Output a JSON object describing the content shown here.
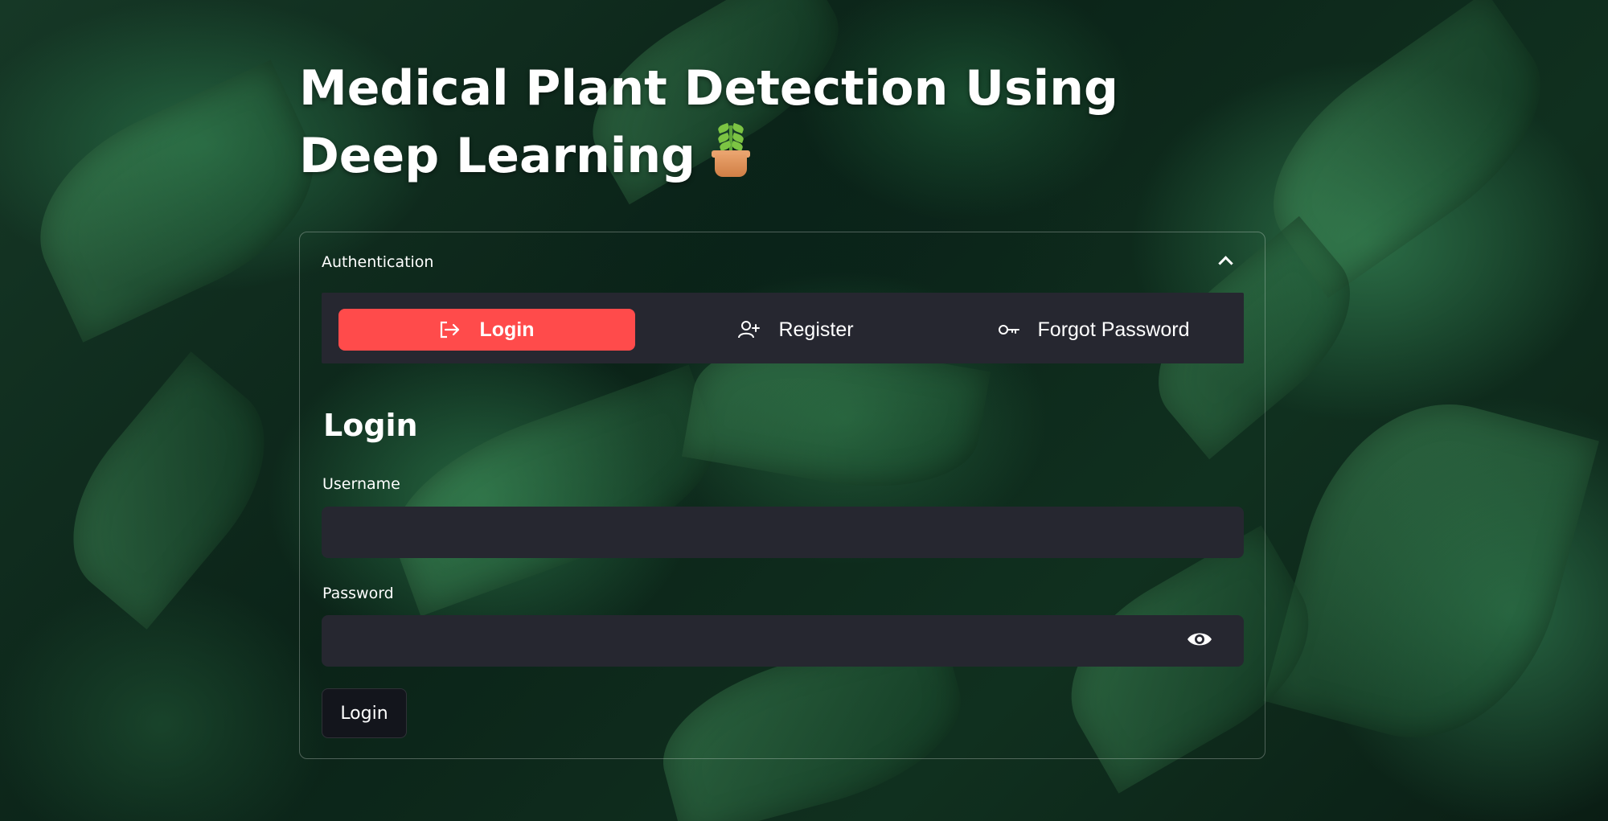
{
  "page": {
    "title": "Medical Plant Detection Using Deep Learning",
    "title_icon": "potted-plant-icon"
  },
  "auth": {
    "expander_label": "Authentication",
    "expander_icon": "chevron-up-icon",
    "tabs": [
      {
        "label": "Login",
        "icon": "login-arrow-icon",
        "active": true
      },
      {
        "label": "Register",
        "icon": "user-plus-icon",
        "active": false
      },
      {
        "label": "Forgot Password",
        "icon": "key-icon",
        "active": false
      }
    ],
    "form": {
      "heading": "Login",
      "username_label": "Username",
      "username_value": "",
      "password_label": "Password",
      "password_value": "",
      "password_toggle_icon": "eye-icon",
      "submit_label": "Login"
    }
  },
  "colors": {
    "accent": "#ff4b4b",
    "input_bg": "#262730",
    "button_bg": "#13151c",
    "text": "#ffffff"
  }
}
